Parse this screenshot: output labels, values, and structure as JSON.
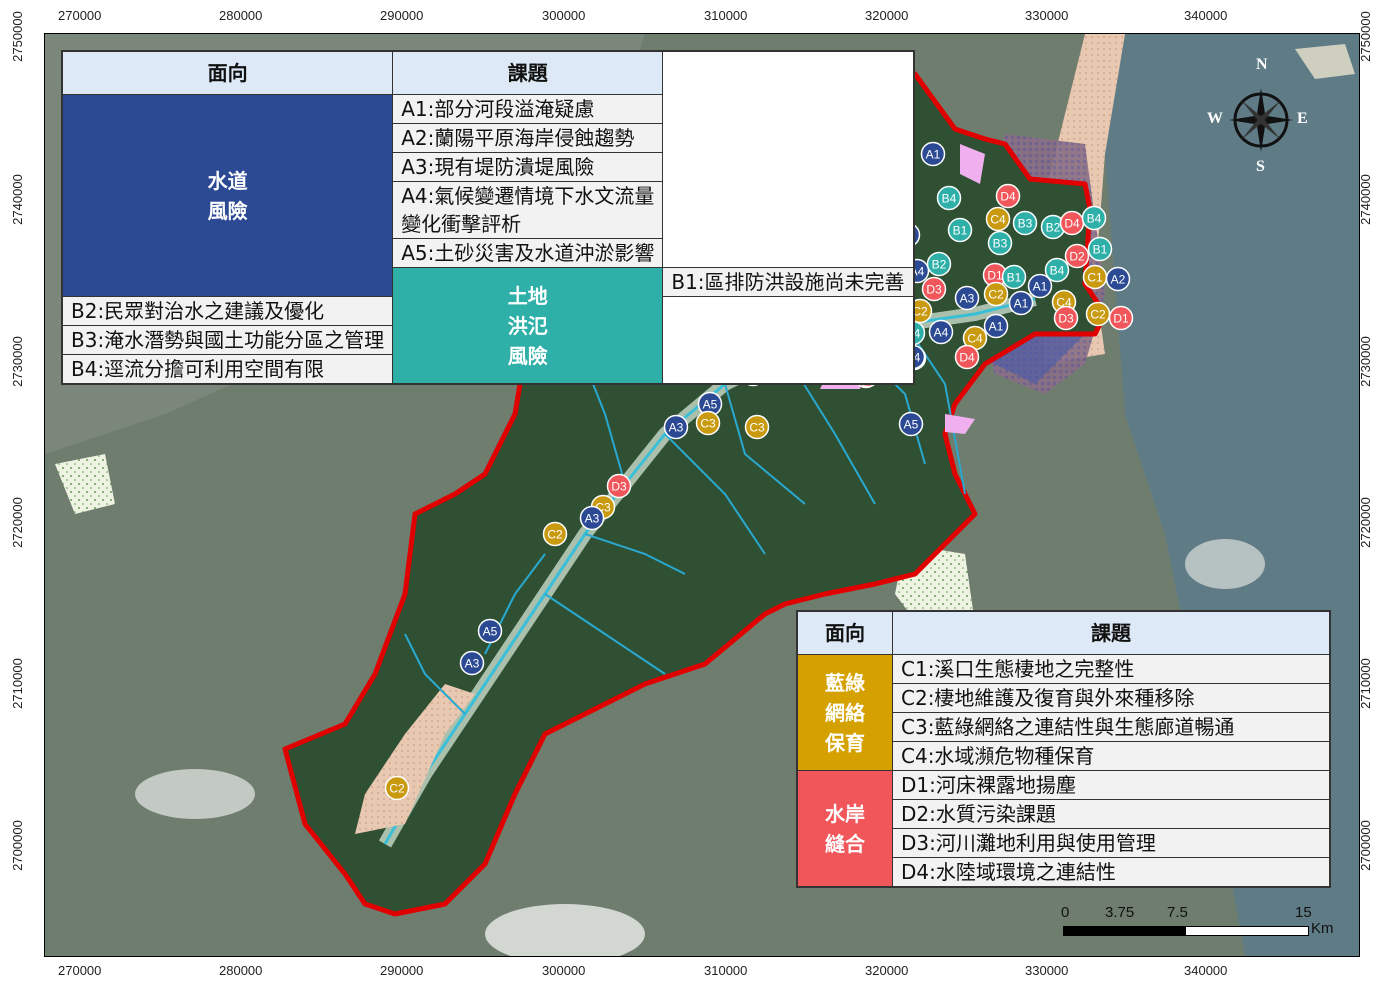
{
  "axes": {
    "x_ticks": [
      "270000",
      "280000",
      "290000",
      "300000",
      "310000",
      "320000",
      "330000",
      "340000"
    ],
    "y_ticks": [
      "2750000",
      "2740000",
      "2730000",
      "2720000",
      "2710000",
      "2700000"
    ]
  },
  "legend_ab": {
    "header": {
      "aspect": "面向",
      "issue": "課題"
    },
    "groups": [
      {
        "name": "水道\n風險",
        "color": "#2c4a94",
        "items": [
          "A1:部分河段溢淹疑慮",
          "A2:蘭陽平原海岸侵蝕趨勢",
          "A3:現有堤防潰堤風險",
          "A4:氣候變遷情境下水文流量變化衝擊評析",
          "A5:土砂災害及水道沖淤影響"
        ]
      },
      {
        "name": "土地\n洪氾\n風險",
        "color": "#2eb0a8",
        "items": [
          "B1:區排防洪設施尚未完善",
          "B2:民眾對治水之建議及優化",
          "B3:淹水潛勢與國土功能分區之管理",
          "B4:逕流分擔可利用空間有限"
        ]
      }
    ]
  },
  "legend_cd": {
    "header": {
      "aspect": "面向",
      "issue": "課題"
    },
    "groups": [
      {
        "name": "藍綠\n網絡\n保育",
        "color": "#d4a100",
        "items": [
          "C1:溪口生態棲地之完整性",
          "C2:棲地維護及復育與外來種移除",
          "C3:藍綠網絡之連結性與生態廊道暢通",
          "C4:水域瀕危物種保育"
        ]
      },
      {
        "name": "水岸\n縫合",
        "color": "#f0565a",
        "items": [
          "D1:河床裸露地揚塵",
          "D2:水質污染課題",
          "D3:河川灘地利用與使用管理",
          "D4:水陸域環境之連結性"
        ]
      }
    ]
  },
  "compass": {
    "n": "N",
    "s": "S",
    "e": "E",
    "w": "W"
  },
  "scale_bar": {
    "labels": [
      "0",
      "3.75",
      "7.5",
      "15"
    ],
    "unit": "Km"
  },
  "marker_colors": {
    "A": "#2c4a94",
    "B": "#2eb0a8",
    "C": "#c99a10",
    "D": "#f0565a"
  },
  "markers": [
    {
      "label": "C2"
    },
    {
      "label": "A1"
    },
    {
      "label": "C2"
    },
    {
      "label": "B4"
    },
    {
      "label": "D4"
    },
    {
      "label": "C4"
    },
    {
      "label": "B3"
    },
    {
      "label": "B2"
    },
    {
      "label": "D4"
    },
    {
      "label": "B4"
    },
    {
      "label": "A1"
    },
    {
      "label": "B1"
    },
    {
      "label": "B3"
    },
    {
      "label": "D2"
    },
    {
      "label": "B1"
    },
    {
      "label": "A4"
    },
    {
      "label": "B2"
    },
    {
      "label": "D1"
    },
    {
      "label": "B1"
    },
    {
      "label": "B4"
    },
    {
      "label": "C1"
    },
    {
      "label": "A2"
    },
    {
      "label": "C2"
    },
    {
      "label": "D1"
    },
    {
      "label": "D3"
    },
    {
      "label": "A3"
    },
    {
      "label": "C2"
    },
    {
      "label": "A1"
    },
    {
      "label": "A1"
    },
    {
      "label": "C4"
    },
    {
      "label": "A1"
    },
    {
      "label": "C3"
    },
    {
      "label": "C2"
    },
    {
      "label": "D3"
    },
    {
      "label": "C2"
    },
    {
      "label": "D1"
    },
    {
      "label": "D3"
    },
    {
      "label": "B4"
    },
    {
      "label": "A4"
    },
    {
      "label": "A1"
    },
    {
      "label": "D3"
    },
    {
      "label": "A4"
    },
    {
      "label": "B2"
    },
    {
      "label": "A4"
    },
    {
      "label": "C4"
    },
    {
      "label": "D4"
    },
    {
      "label": "D4"
    },
    {
      "label": "C2"
    },
    {
      "label": "C3"
    },
    {
      "label": "A5"
    },
    {
      "label": "A3"
    },
    {
      "label": "C3"
    },
    {
      "label": "C3"
    },
    {
      "label": "A5"
    },
    {
      "label": "D3"
    },
    {
      "label": "C3"
    },
    {
      "label": "A3"
    },
    {
      "label": "C2"
    },
    {
      "label": "A5"
    },
    {
      "label": "A3"
    },
    {
      "label": "C2"
    }
  ]
}
